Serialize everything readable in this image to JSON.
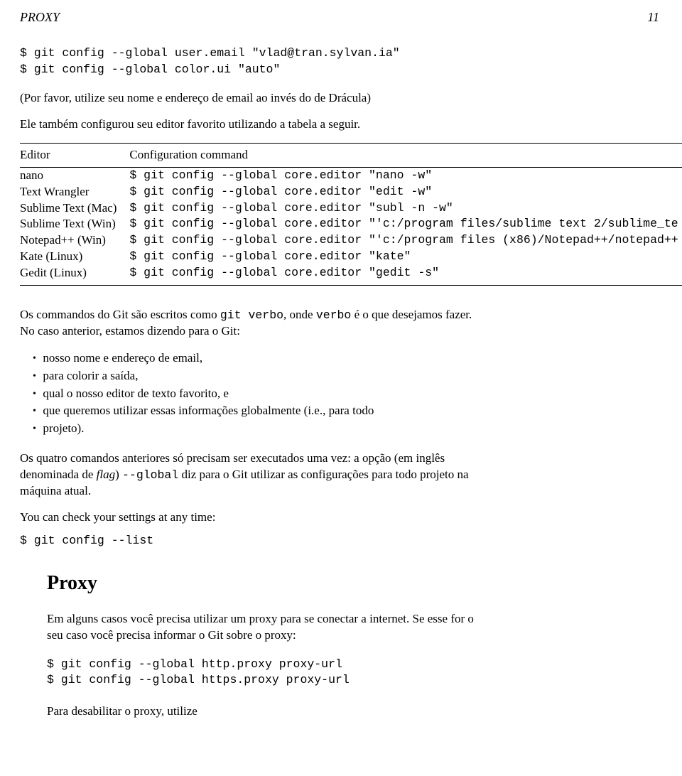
{
  "running_head": {
    "left": "PROXY",
    "right": "11"
  },
  "cmd1": "$ git config --global user.email \"vlad@tran.sylvan.ia\"\n$ git config --global color.ui \"auto\"",
  "para1": "(Por favor, utilize seu nome e endereço de email ao invés do de Drácula)",
  "para2": "Ele também configurou seu editor favorito utilizando a tabela a seguir.",
  "table": {
    "head": {
      "c0": "Editor",
      "c1": "Configuration command"
    },
    "rows": [
      {
        "c0": "nano",
        "c1": "$ git config --global core.editor \"nano -w\""
      },
      {
        "c0": "Text Wrangler",
        "c1": "$ git config --global core.editor \"edit -w\""
      },
      {
        "c0": "Sublime Text (Mac)",
        "c1": "$ git config --global core.editor \"subl -n -w\""
      },
      {
        "c0": "Sublime Text (Win)",
        "c1": "$ git config --global core.editor \"'c:/program files/sublime text 2/sublime_te"
      },
      {
        "c0": "Notepad++ (Win)",
        "c1": "$ git config --global core.editor \"'c:/program files (x86)/Notepad++/notepad++"
      },
      {
        "c0": "Kate (Linux)",
        "c1": "$ git config --global core.editor \"kate\""
      },
      {
        "c0": "Gedit (Linux)",
        "c1": "$ git config --global core.editor \"gedit -s\""
      }
    ]
  },
  "para3_a": "Os commandos do Git são escritos como ",
  "para3_b": "git verbo",
  "para3_c": ", onde ",
  "para3_d": "verbo",
  "para3_e": " é o que desejamos fazer. No caso anterior, estamos dizendo para o Git:",
  "bullets": [
    "nosso nome e endereço de email,",
    "para colorir a saída,",
    "qual o nosso editor de texto favorito, e",
    "que queremos utilizar essas informações globalmente (i.e., para todo",
    "projeto)."
  ],
  "para4_a": "Os quatro comandos anteriores só precisam ser executados uma vez: a opção (em inglês denominada de ",
  "para4_b": "flag",
  "para4_c": ") ",
  "para4_d": "--global",
  "para4_e": " diz para o Git utilizar as configurações para todo projeto na máquina atual.",
  "para5": "You can check your settings at any time:",
  "cmd2": "$ git config --list",
  "section": {
    "title": "Proxy",
    "para1": "Em alguns casos você precisa utilizar um proxy para se conectar a internet. Se esse for o seu caso você precisa informar o Git sobre o proxy:",
    "cmd": "$ git config --global http.proxy proxy-url\n$ git config --global https.proxy proxy-url",
    "para2": "Para desabilitar o proxy, utilize"
  }
}
